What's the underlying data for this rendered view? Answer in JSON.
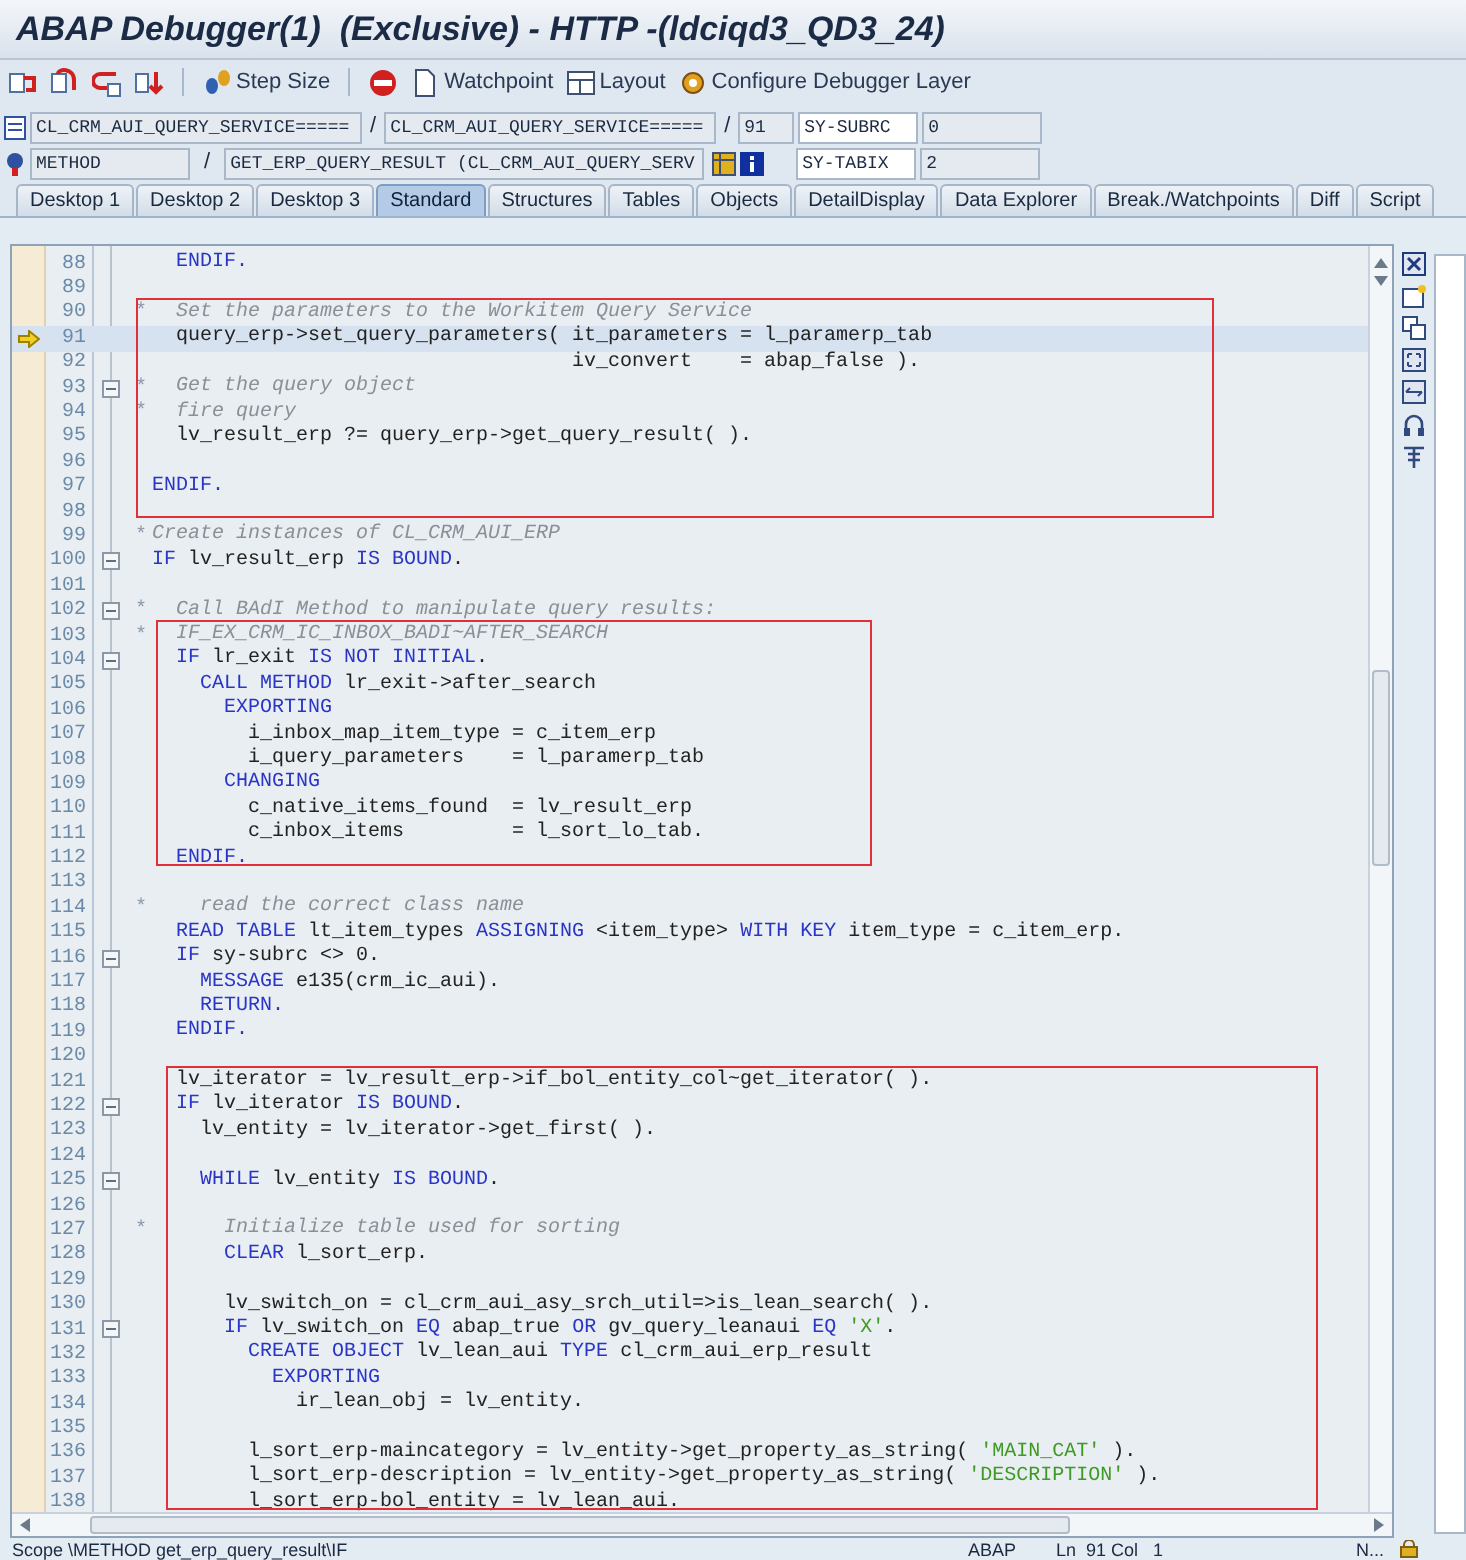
{
  "window": {
    "title": "ABAP Debugger(1)  (Exclusive) - HTTP -(ldciqd3_QD3_24)"
  },
  "toolbar": [
    {
      "kind": "icon"
    },
    {
      "kind": "icon"
    },
    {
      "kind": "icon"
    },
    {
      "kind": "icon"
    },
    {
      "kind": "separator"
    },
    {
      "kind": "button",
      "label": "Step Size"
    },
    {
      "kind": "separator"
    },
    {
      "kind": "icon"
    },
    {
      "kind": "button",
      "label": "Watchpoint"
    },
    {
      "kind": "button",
      "label": "Layout"
    },
    {
      "kind": "button",
      "label": "Configure Debugger Layer"
    }
  ],
  "source_row": {
    "program": "CL_CRM_AUI_QUERY_SERVICE=====",
    "separator_1": "/",
    "include": "CL_CRM_AUI_QUERY_SERVICE=====",
    "separator_2": "/",
    "line": "91",
    "field_name": "SY-SUBRC",
    "field_value": "0"
  },
  "event_row": {
    "event_type": "METHOD",
    "separator": "/",
    "event": "GET_ERP_QUERY_RESULT (CL_CRM_AUI_QUERY_SERV",
    "field_name": "SY-TABIX",
    "field_value": "2"
  },
  "tabs": [
    {
      "label": "Desktop 1",
      "selected": false
    },
    {
      "label": "Desktop 2",
      "selected": false
    },
    {
      "label": "Desktop 3",
      "selected": false
    },
    {
      "label": "Standard",
      "selected": true
    },
    {
      "label": "Structures",
      "selected": false
    },
    {
      "label": "Tables",
      "selected": false
    },
    {
      "label": "Objects",
      "selected": false
    },
    {
      "label": "DetailDisplay",
      "selected": false
    },
    {
      "label": "Data Explorer",
      "selected": false
    },
    {
      "label": "Break./Watchpoints",
      "selected": false
    },
    {
      "label": "Diff",
      "selected": false
    },
    {
      "label": "Script",
      "selected": false
    }
  ],
  "code_blocks": [
    {
      "framed": false,
      "lines": [
        {
          "no": "88",
          "fold": false,
          "current": false,
          "segments": [
            {
              "kind": "kw",
              "text": "  ENDIF."
            }
          ]
        },
        {
          "no": "89",
          "fold": false,
          "current": false
        }
      ]
    },
    {
      "framed": true,
      "lines": [
        {
          "no": "90",
          "fold": false,
          "current": false,
          "marker": "*",
          "segments": [
            {
              "kind": "cmt",
              "text": "  Set the parameters to the Workitem Query Service"
            }
          ]
        },
        {
          "no": "91",
          "fold": false,
          "current": true,
          "segments": [
            {
              "kind": "plain",
              "text": "  query_erp->set_query_parameters( it_parameters = l_paramerp_tab"
            }
          ]
        },
        {
          "no": "92",
          "fold": false,
          "current": false,
          "segments": [
            {
              "kind": "plain",
              "text": "                                   iv_convert    = abap_false )."
            }
          ]
        },
        {
          "no": "93",
          "fold": true,
          "current": false,
          "marker": "*",
          "segments": [
            {
              "kind": "cmt",
              "text": "  Get the query object"
            }
          ]
        },
        {
          "no": "94",
          "fold": false,
          "current": false,
          "marker": "*",
          "segments": [
            {
              "kind": "cmt",
              "text": "  fire query"
            }
          ]
        },
        {
          "no": "95",
          "fold": false,
          "current": false,
          "segments": [
            {
              "kind": "plain",
              "text": "  lv_result_erp ?= query_erp->get_query_result( )."
            }
          ]
        },
        {
          "no": "96",
          "fold": false,
          "current": false
        },
        {
          "no": "97",
          "fold": false,
          "current": false,
          "segments": [
            {
              "kind": "kw",
              "text": "ENDIF."
            }
          ]
        },
        {
          "no": "98",
          "fold": false,
          "current": false
        }
      ]
    },
    {
      "framed": false,
      "lines": [
        {
          "no": "99",
          "fold": false,
          "current": false,
          "marker": "*",
          "segments": [
            {
              "kind": "cmt",
              "text": "Create instances of CL_CRM_AUI_ERP"
            }
          ]
        },
        {
          "no": "100",
          "fold": true,
          "current": false,
          "segments": [
            {
              "kind": "kw",
              "text": "IF"
            },
            {
              "kind": "plain",
              "text": " lv_result_erp "
            },
            {
              "kind": "kw",
              "text": "IS BOUND"
            },
            {
              "kind": "plain",
              "text": "."
            }
          ]
        },
        {
          "no": "101",
          "fold": false,
          "current": false
        },
        {
          "no": "102",
          "fold": true,
          "current": false,
          "marker": "*",
          "segments": [
            {
              "kind": "cmt",
              "text": "  Call BAdI Method to manipulate query results:"
            }
          ]
        }
      ]
    },
    {
      "framed": true,
      "lines": [
        {
          "no": "103",
          "fold": false,
          "current": false,
          "marker": "*",
          "segments": [
            {
              "kind": "cmt",
              "text": "  IF_EX_CRM_IC_INBOX_BADI~AFTER_SEARCH"
            }
          ]
        },
        {
          "no": "104",
          "fold": true,
          "current": false,
          "segments": [
            {
              "kind": "kw",
              "text": "  IF"
            },
            {
              "kind": "plain",
              "text": " lr_exit "
            },
            {
              "kind": "kw",
              "text": "IS NOT INITIAL"
            },
            {
              "kind": "plain",
              "text": "."
            }
          ]
        },
        {
          "no": "105",
          "fold": false,
          "current": false,
          "segments": [
            {
              "kind": "kw",
              "text": "    CALL METHOD"
            },
            {
              "kind": "plain",
              "text": " lr_exit->after_search"
            }
          ]
        },
        {
          "no": "106",
          "fold": false,
          "current": false,
          "segments": [
            {
              "kind": "kw",
              "text": "      EXPORTING"
            }
          ]
        },
        {
          "no": "107",
          "fold": false,
          "current": false,
          "segments": [
            {
              "kind": "plain",
              "text": "        i_inbox_map_item_type = c_item_erp"
            }
          ]
        },
        {
          "no": "108",
          "fold": false,
          "current": false,
          "segments": [
            {
              "kind": "plain",
              "text": "        i_query_parameters    = l_paramerp_tab"
            }
          ]
        },
        {
          "no": "109",
          "fold": false,
          "current": false,
          "segments": [
            {
              "kind": "kw",
              "text": "      CHANGING"
            }
          ]
        },
        {
          "no": "110",
          "fold": false,
          "current": false,
          "segments": [
            {
              "kind": "plain",
              "text": "        c_native_items_found  = lv_result_erp"
            }
          ]
        },
        {
          "no": "111",
          "fold": false,
          "current": false,
          "segments": [
            {
              "kind": "plain",
              "text": "        c_inbox_items         = l_sort_lo_tab."
            }
          ]
        },
        {
          "no": "112",
          "fold": false,
          "current": false,
          "segments": [
            {
              "kind": "kw",
              "text": "  ENDIF."
            }
          ]
        }
      ]
    },
    {
      "framed": false,
      "lines": [
        {
          "no": "113",
          "fold": false,
          "current": false
        },
        {
          "no": "114",
          "fold": false,
          "current": false,
          "marker": "*",
          "segments": [
            {
              "kind": "cmt",
              "text": "    read the correct class name"
            }
          ]
        },
        {
          "no": "115",
          "fold": false,
          "current": false,
          "segments": [
            {
              "kind": "kw",
              "text": "  READ TABLE"
            },
            {
              "kind": "plain",
              "text": " lt_item_types "
            },
            {
              "kind": "kw",
              "text": "ASSIGNING"
            },
            {
              "kind": "plain",
              "text": " <item_type> "
            },
            {
              "kind": "kw",
              "text": "WITH KEY"
            },
            {
              "kind": "plain",
              "text": " item_type = c_item_erp."
            }
          ]
        },
        {
          "no": "116",
          "fold": true,
          "current": false,
          "segments": [
            {
              "kind": "kw",
              "text": "  IF"
            },
            {
              "kind": "plain",
              "text": " sy-subrc <> 0."
            }
          ]
        },
        {
          "no": "117",
          "fold": false,
          "current": false,
          "segments": [
            {
              "kind": "kw",
              "text": "    MESSAGE"
            },
            {
              "kind": "plain",
              "text": " e135(crm_ic_aui)."
            }
          ]
        },
        {
          "no": "118",
          "fold": false,
          "current": false,
          "segments": [
            {
              "kind": "kw",
              "text": "    RETURN."
            }
          ]
        },
        {
          "no": "119",
          "fold": false,
          "current": false,
          "segments": [
            {
              "kind": "kw",
              "text": "  ENDIF."
            }
          ]
        },
        {
          "no": "120",
          "fold": false,
          "current": false
        }
      ]
    },
    {
      "framed": true,
      "lines": [
        {
          "no": "121",
          "fold": false,
          "current": false,
          "segments": [
            {
              "kind": "plain",
              "text": "  lv_iterator = lv_result_erp->if_bol_entity_col~get_iterator( )."
            }
          ]
        },
        {
          "no": "122",
          "fold": true,
          "current": false,
          "segments": [
            {
              "kind": "kw",
              "text": "  IF"
            },
            {
              "kind": "plain",
              "text": " lv_iterator "
            },
            {
              "kind": "kw",
              "text": "IS BOUND"
            },
            {
              "kind": "plain",
              "text": "."
            }
          ]
        },
        {
          "no": "123",
          "fold": false,
          "current": false,
          "segments": [
            {
              "kind": "plain",
              "text": "    lv_entity = lv_iterator->get_first( )."
            }
          ]
        },
        {
          "no": "124",
          "fold": false,
          "current": false
        },
        {
          "no": "125",
          "fold": true,
          "current": false,
          "segments": [
            {
              "kind": "kw",
              "text": "    WHILE"
            },
            {
              "kind": "plain",
              "text": " lv_entity "
            },
            {
              "kind": "kw",
              "text": "IS BOUND"
            },
            {
              "kind": "plain",
              "text": "."
            }
          ]
        },
        {
          "no": "126",
          "fold": false,
          "current": false
        },
        {
          "no": "127",
          "fold": false,
          "current": false,
          "marker": "*",
          "segments": [
            {
              "kind": "cmt",
              "text": "      Initialize table used for sorting"
            }
          ]
        },
        {
          "no": "128",
          "fold": false,
          "current": false,
          "segments": [
            {
              "kind": "kw",
              "text": "      CLEAR"
            },
            {
              "kind": "plain",
              "text": " l_sort_erp."
            }
          ]
        },
        {
          "no": "129",
          "fold": false,
          "current": false
        },
        {
          "no": "130",
          "fold": false,
          "current": false,
          "segments": [
            {
              "kind": "plain",
              "text": "      lv_switch_on = cl_crm_aui_asy_srch_util=>is_lean_search( )."
            }
          ]
        },
        {
          "no": "131",
          "fold": true,
          "current": false,
          "segments": [
            {
              "kind": "kw",
              "text": "      IF"
            },
            {
              "kind": "plain",
              "text": " lv_switch_on "
            },
            {
              "kind": "kw",
              "text": "EQ"
            },
            {
              "kind": "plain",
              "text": " abap_true "
            },
            {
              "kind": "kw",
              "text": "OR"
            },
            {
              "kind": "plain",
              "text": " gv_query_leanaui "
            },
            {
              "kind": "kw",
              "text": "EQ"
            },
            {
              "kind": "str",
              "text": " 'X'"
            },
            {
              "kind": "plain",
              "text": "."
            }
          ]
        },
        {
          "no": "132",
          "fold": false,
          "current": false,
          "segments": [
            {
              "kind": "kw",
              "text": "        CREATE OBJECT"
            },
            {
              "kind": "plain",
              "text": " lv_lean_aui "
            },
            {
              "kind": "kw",
              "text": "TYPE"
            },
            {
              "kind": "plain",
              "text": " cl_crm_aui_erp_result"
            }
          ]
        },
        {
          "no": "133",
          "fold": false,
          "current": false,
          "segments": [
            {
              "kind": "kw",
              "text": "          EXPORTING"
            }
          ]
        },
        {
          "no": "134",
          "fold": false,
          "current": false,
          "segments": [
            {
              "kind": "plain",
              "text": "            ir_lean_obj = lv_entity."
            }
          ]
        },
        {
          "no": "135",
          "fold": false,
          "current": false
        },
        {
          "no": "136",
          "fold": false,
          "current": false,
          "segments": [
            {
              "kind": "plain",
              "text": "        l_sort_erp-maincategory = lv_entity->get_property_as_string( "
            },
            {
              "kind": "str",
              "text": "'MAIN_CAT'"
            },
            {
              "kind": "plain",
              "text": " )."
            }
          ]
        },
        {
          "no": "137",
          "fold": false,
          "current": false,
          "segments": [
            {
              "kind": "plain",
              "text": "        l_sort_erp-description = lv_entity->get_property_as_string( "
            },
            {
              "kind": "str",
              "text": "'DESCRIPTION'"
            },
            {
              "kind": "plain",
              "text": " )."
            }
          ]
        },
        {
          "no": "138",
          "fold": false,
          "current": false,
          "segments": [
            {
              "kind": "plain",
              "text": "        l_sort_erp-bol_entity = lv_lean_aui."
            }
          ]
        }
      ]
    }
  ],
  "status_bar": {
    "scope": "Scope \\METHOD get_erp_query_result\\IF",
    "language": "ABAP",
    "position": "Ln  91 Col   1",
    "mode": "N..."
  }
}
